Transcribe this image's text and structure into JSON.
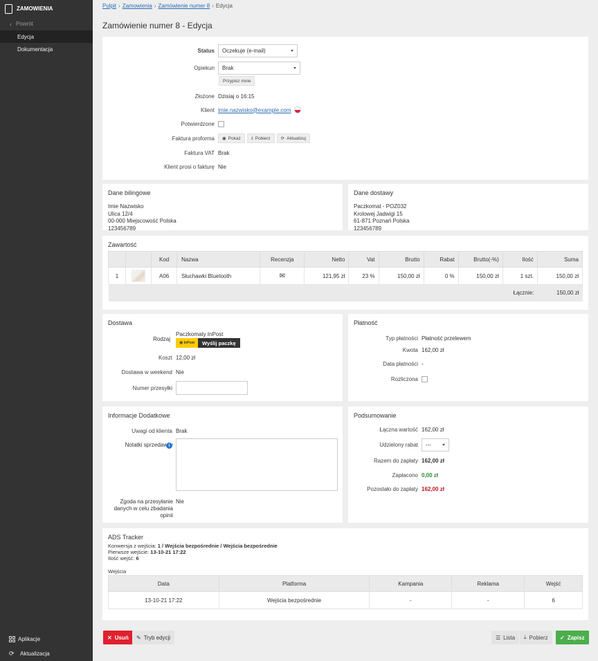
{
  "sidebar": {
    "app_title": "ZAMOWIENIA",
    "back_label": "Powrót",
    "items": [
      {
        "label": "Edycja",
        "active": true
      },
      {
        "label": "Dokumentacja",
        "active": false
      }
    ],
    "bottom": [
      {
        "label": "Aplikacje",
        "icon": "grid-icon"
      },
      {
        "label": "Aktualizacja",
        "icon": "refresh-icon"
      }
    ]
  },
  "breadcrumb": {
    "items": [
      "Pulpit",
      "Zamowienia",
      "Zamówienie numer 8"
    ],
    "current": "Edycja"
  },
  "page_title": "Zamówienie numer 8 - Edycja",
  "order": {
    "status_label": "Status",
    "status_value": "Oczekuje (e-mail)",
    "opiekun_label": "Opiekun",
    "opiekun_value": "Brak",
    "assign_me": "Przypisz mnie",
    "zlozone_label": "Złożone",
    "zlozone_value": "Dzisiaj o 16:15",
    "klient_label": "Klient",
    "klient_value": "imie.nazwisko@example.com",
    "potwierdzone_label": "Potwierdzone",
    "proforma_label": "Faktura proforma",
    "proforma_buttons": {
      "show": "Pokaż",
      "download": "Pobierz",
      "update": "Aktualizuj"
    },
    "vat_label": "Faktura VAT",
    "vat_value": "Brak",
    "wants_invoice_label": "Klient prosi o fakturę",
    "wants_invoice_value": "Nie"
  },
  "billing": {
    "title": "Dane bilingowe",
    "lines": [
      "Imie Nazwisko",
      "Ulica 12/4",
      "00-000 Miejscowość Polska",
      "123456789"
    ]
  },
  "shipping": {
    "title": "Dane dostawy",
    "lines": [
      "Paczkomat - POZ032",
      "Krolowej Jadwigi 15",
      "61-871 Poznań Polska",
      "123456789"
    ]
  },
  "contents": {
    "title": "Zawartość",
    "columns": [
      "",
      "",
      "Kod",
      "Nazwa",
      "Recenzja",
      "Netto",
      "Vat",
      "Brutto",
      "Rabat",
      "Brutto(-%)",
      "Ilość",
      "Suma"
    ],
    "rows": [
      {
        "lp": "1",
        "kod": "A06",
        "nazwa": "Słuchawki Bluetooth",
        "netto": "121,95 zł",
        "vat": "23 %",
        "brutto": "150,00 zł",
        "rabat": "0 %",
        "brutto_rabat": "150,00 zł",
        "ilosc": "1 szt.",
        "suma": "150,00 zł"
      }
    ],
    "total_label": "Łącznie:",
    "total_value": "150,00 zł"
  },
  "delivery": {
    "title": "Dostawa",
    "rodzaj_label": "Rodzaj",
    "rodzaj_value": "Paczkomaty InPost",
    "inpost_logo": "InPost",
    "send_button": "Wyślij paczkę",
    "koszt_label": "Koszt",
    "koszt_value": "12,00 zł",
    "weekend_label": "Dostawa w weekend",
    "weekend_value": "Nie",
    "tracking_label": "Numer przesyłki",
    "tracking_value": ""
  },
  "payment": {
    "title": "Płatność",
    "type_label": "Typ płatności",
    "type_value": "Płatność przelewem",
    "kwota_label": "Kwota",
    "kwota_value": "162,00 zł",
    "date_label": "Data płatności",
    "date_value": "-",
    "settled_label": "Rozliczona"
  },
  "additional": {
    "title": "Informacje Dodatkowe",
    "remarks_label": "Uwagi od klienta",
    "remarks_value": "Brak",
    "notes_label": "Notatki sprzedawcy",
    "notes_value": "",
    "consent_label_lines": [
      "Zgoda na przesyłanie",
      "danych w celu zbadania",
      "opinii"
    ],
    "consent_value": "Nie"
  },
  "summary": {
    "title": "Podsumowanie",
    "total_label": "Łączna wartość",
    "total_value": "162,00 zł",
    "discount_label": "Udzielony rabat",
    "discount_value": "---",
    "to_pay_label": "Razem do zapłaty",
    "to_pay_value": "162,00 zł",
    "paid_label": "Zapłacono",
    "paid_value": "0,00 zł",
    "left_label": "Pozostało do zapłaty",
    "left_value": "162,00 zł"
  },
  "ads": {
    "title": "ADS Tracker",
    "conv_label": "Konwersja z wejścia:",
    "conv_value": "1 / Wejścia bezpośrednie / Wejścia bezpośrednie",
    "first_label": "Pierwsze wejście:",
    "first_value": "13-10-21 17:22",
    "count_label": "Ilość wejść:",
    "count_value": "6",
    "entries_label": "Wejścia",
    "columns": [
      "Data",
      "Platforma",
      "Kampania",
      "Reklama",
      "Wejść"
    ],
    "rows": [
      {
        "data": "13-10-21 17:22",
        "platforma": "Wejścia bezpośrednie",
        "kampania": "-",
        "reklama": "-",
        "wejsc": "6"
      }
    ]
  },
  "actions": {
    "delete": "Usuń",
    "edit_mode": "Tryb edycji",
    "list": "Lista",
    "download": "Pobierz",
    "save": "Zapisz"
  },
  "colors": {
    "sidebar_bg": "#333333",
    "danger": "#e0202e",
    "success": "#4cae4c",
    "paid_green": "#2e8b2e",
    "due_red": "#c0121e",
    "link": "#2a6db0"
  }
}
